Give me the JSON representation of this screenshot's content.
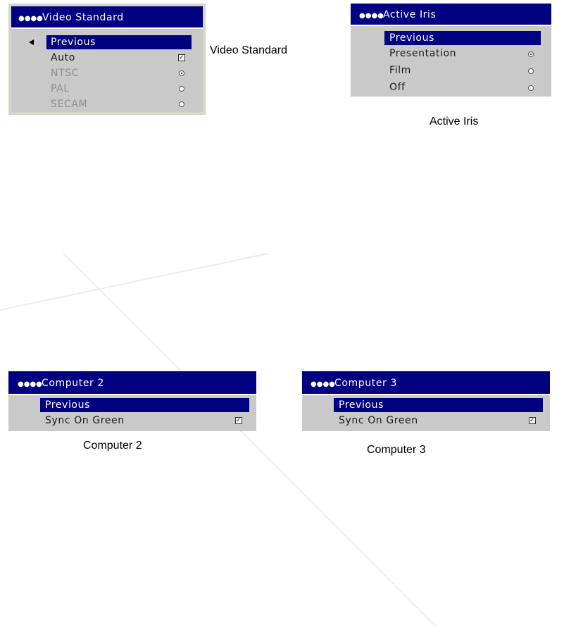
{
  "panels": {
    "video_standard": {
      "title": "Video Standard",
      "items": [
        {
          "label": "Previous"
        },
        {
          "label": "Auto"
        },
        {
          "label": "NTSC"
        },
        {
          "label": "PAL"
        },
        {
          "label": "SECAM"
        }
      ],
      "caption": "Video Standard"
    },
    "active_iris": {
      "title": "Active Iris",
      "items": [
        {
          "label": "Previous"
        },
        {
          "label": "Presentation"
        },
        {
          "label": "Film"
        },
        {
          "label": "Off"
        }
      ],
      "caption": "Active Iris"
    },
    "computer_2": {
      "title": "Computer 2",
      "items": [
        {
          "label": "Previous"
        },
        {
          "label": "Sync On Green"
        }
      ],
      "caption": "Computer 2"
    },
    "computer_3": {
      "title": "Computer 3",
      "items": [
        {
          "label": "Previous"
        },
        {
          "label": "Sync On Green"
        }
      ],
      "caption": "Computer 3"
    }
  },
  "colors": {
    "title_bar": "#000080",
    "panel_bg": "#c9c9c9",
    "disabled_text": "#8f8f8f"
  },
  "icons": {
    "title_marker": "four-dots-icon",
    "back": "left-arrow-icon",
    "checkbox": "checkbox-icon",
    "radio": "radio-icon"
  }
}
